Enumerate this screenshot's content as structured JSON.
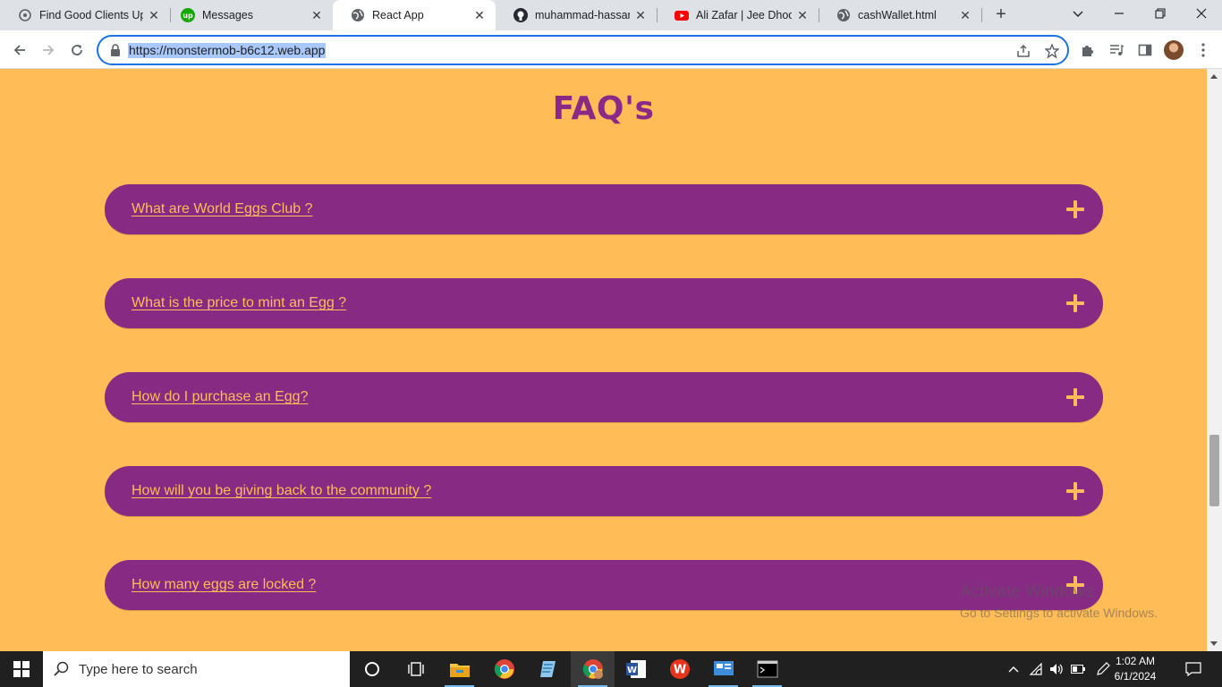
{
  "browser": {
    "tabs": [
      {
        "title": "Find Good Clients Upw",
        "icon": "upwork-logo-icon"
      },
      {
        "title": "Messages",
        "icon": "upwork-up-icon"
      },
      {
        "title": "React App",
        "icon": "globe-icon",
        "active": true
      },
      {
        "title": "muhammad-hassan-n",
        "icon": "github-icon"
      },
      {
        "title": "Ali Zafar | Jee Dhoond",
        "icon": "youtube-icon"
      },
      {
        "title": "cashWallet.html",
        "icon": "globe-icon"
      }
    ],
    "url": "https://monstermob-b6c12.web.app"
  },
  "page": {
    "title": "FAQ's",
    "faqs": [
      {
        "question": "What are World Eggs Club ?"
      },
      {
        "question": "What is the price to mint an Egg ?"
      },
      {
        "question": "How do I purchase an Egg?"
      },
      {
        "question": "How will you be giving back to the community ?"
      },
      {
        "question": "How many eggs are locked ?"
      }
    ],
    "colors": {
      "background": "#ffbc57",
      "accent": "#872a84"
    }
  },
  "watermark": {
    "line1": "Activate Windows",
    "line2": "Go to Settings to activate Windows."
  },
  "taskbar": {
    "search_placeholder": "Type here to search",
    "time": "1:02 AM",
    "date": "6/1/2024",
    "apps": [
      "cortana-icon",
      "task-view-icon",
      "file-explorer-icon",
      "chrome-icon",
      "notepad-icon",
      "chrome-profile-icon",
      "word-icon",
      "wps-icon",
      "control-panel-icon",
      "terminal-icon"
    ]
  }
}
